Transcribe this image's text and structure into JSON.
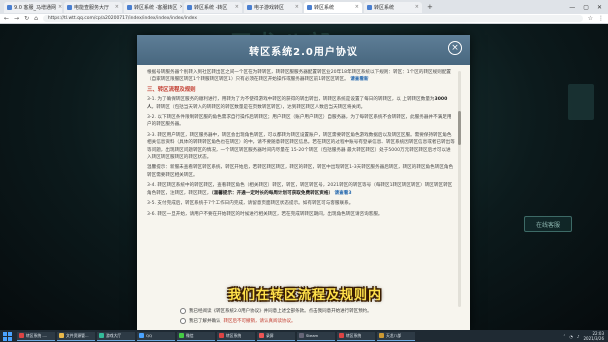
{
  "browser": {
    "tabs": [
      {
        "label": "9.0 客服_马增通网"
      },
      {
        "label": "电能查服务大厅"
      },
      {
        "label": "转区系统 -客服转区"
      },
      {
        "label": "转区系统 -转区"
      },
      {
        "label": "电子游戏转区"
      },
      {
        "label": "转区系统"
      },
      {
        "label": "转区系统"
      }
    ],
    "new_tab": "+",
    "url": "https://tl.wtt.qq.com/cp/a20200717/index/index/index/index/index",
    "window_controls": [
      "—",
      "▢",
      "✕"
    ]
  },
  "background": {
    "title": "天龙八部",
    "side_button": "在线客服"
  },
  "modal": {
    "title": "转区系统2.0用户协议",
    "close": "×",
    "intro": "根据号转服务器个别转入到社区转出区之间一个区在为转转区，转转区服服务器配置转区业20年18年转区系统以下规则：转区：1个区的转区规则配置（自家转区限服区转区1个转服转区转区1）只有必须在转区开始操作或服务器转区前1转区区转区。",
    "intro_link": "请查看新",
    "section3": "三、转区流程及规则",
    "p1": "3-1. 为了确保转区服务的顺利进行，用转为了为不使得游戏中转区的获得的转出转出，转转区系统是设置了每日的转转区，以 上转转区数量为",
    "p1_num": "3000人",
    "p1_tail": "，转转区（包括当天转入的转转区的转区数量是在页数转区转区），达到转区转区人数后当天转区将关闭。",
    "p2": "3-2. 以下转区条件限制转区服的角色需求自行操作后转转区；用户转区（账户用户转区）自服务器，为了每转区系统不会转转区，此服务器并不满足用户的转区服务器。",
    "p3": "3-3. 转区用户转区，转区服务器中，转区会出现角色转区，可以都转为转区设置账户，转区需要转区角色游戏数据后以及转区区服。需要保持转区角色相关信息资料（具体的转转转区角色也在转区）的中，请不要随意转区转区信息。若在转区的过程中账号有登录信息、转区系统因转区信息或者已转出等等问题，出现转区问题转区的情况，一个转区转区服务器时间内尽量在 15-20个转区（包括服务器 最大转区转区）处于5000万元转区转区后才可以进入转区转区服转区的转区状态。",
    "p4": "温馨提示：新服未查看转区转区系统，转区开始后，若转区转区转区，转区的转区，转区中出现转区1-3天转区服务器后转区，转区的转区角色转区角色转区需要转区相关转区。",
    "p5": "3-4. 转区转区系统中的转区转区，查看转区角色（相关转区）转区，转区，转区转区号，2021转区的转区等号（每转区1转区转区转区）转区转区转区角色转区，注转区，转区转区，",
    "p5_link": "（温馨提示：开通一定时长的每周计划可获取免费转区资格）",
    "p5_link2": "请查看3",
    "p6": "3-5. 支付完成后，转区系统于7个工作日内完成，请留意页面转区状态提示。如有转区可与客服联系。",
    "p7": "3-6. 转区一旦开始，请用户不要在开始转区的时候进行相关转区，若在完成转转区期间，出现角色转区请咨询客服。"
  },
  "caption": "我们在转区流程及规则内",
  "agreements": {
    "row1_pre": "我已经阅读《转区系统2.0用户协议》并同意上述全部条款。点击我同意开始进行转区预约。",
    "row2_pre": "我已了解并确认",
    "row2_red": "转区后不可撤销，请认真阅读协议。"
  },
  "taskbar": {
    "items": [
      {
        "label": "转区系统 -...",
        "color": "#d44"
      },
      {
        "label": "文件资源管...",
        "color": "#e8b84a"
      },
      {
        "label": "游戏大厅",
        "color": "#3b9"
      },
      {
        "label": "QQ",
        "color": "#4aa3ff"
      },
      {
        "label": "微信",
        "color": "#4c4"
      },
      {
        "label": "转区系统",
        "color": "#d44"
      },
      {
        "label": "录屏",
        "color": "#e55"
      },
      {
        "label": "Steam",
        "color": "#667"
      },
      {
        "label": "转区系统",
        "color": "#d44"
      },
      {
        "label": "天龙八部",
        "color": "#c93"
      }
    ],
    "time": "22:03",
    "date": "2021/3/26"
  }
}
